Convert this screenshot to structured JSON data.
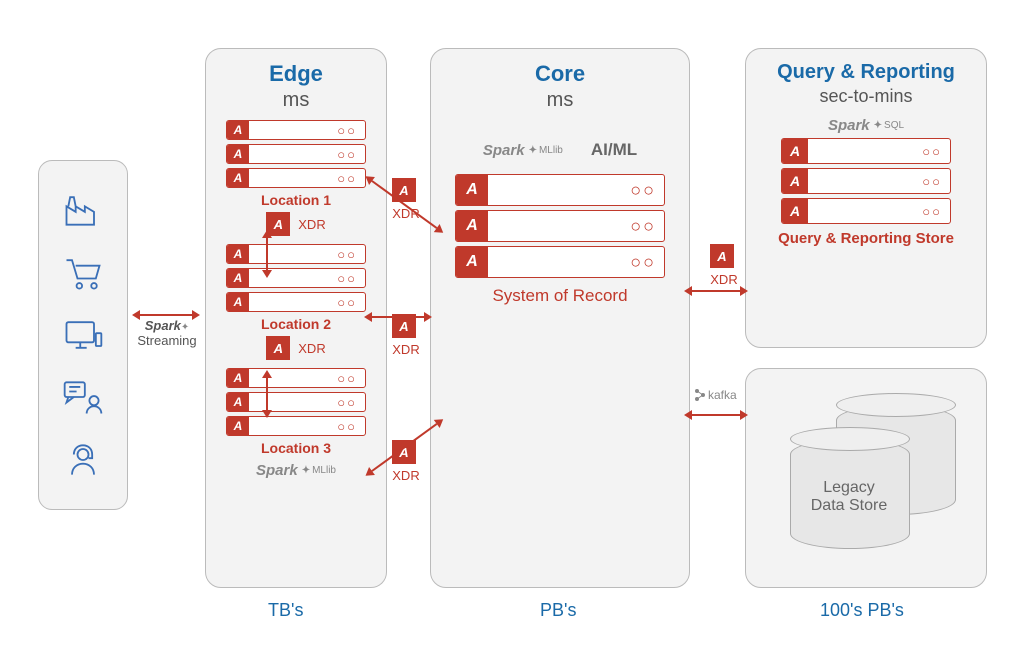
{
  "columns": {
    "edge": {
      "title": "Edge",
      "subtitle": "ms",
      "scale": "TB's"
    },
    "core": {
      "title": "Core",
      "subtitle": "ms",
      "scale": "PB's"
    },
    "query": {
      "title": "Query & Reporting",
      "subtitle": "sec-to-mins",
      "scale": "100's PB's"
    }
  },
  "edge": {
    "locations": [
      "Location 1",
      "Location 2",
      "Location 3"
    ],
    "xdr_label": "XDR",
    "spark_mllib": "Spark",
    "spark_mllib_suffix": "MLlib"
  },
  "core": {
    "spark_mllib": "Spark",
    "spark_mllib_suffix": "MLlib",
    "aiml": "AI/ML",
    "system_of_record": "System of Record"
  },
  "query": {
    "spark_sql": "Spark",
    "spark_sql_suffix": "SQL",
    "store_label": "Query & Reporting Store"
  },
  "legacy": {
    "label_line1": "Legacy",
    "label_line2": "Data Store",
    "kafka_label": "kafka"
  },
  "ingest": {
    "spark_streaming": "Spark",
    "spark_streaming_sub": "Streaming"
  },
  "source_icons": [
    "factory",
    "cart",
    "monitor",
    "chat-user",
    "headset-user"
  ],
  "glyph": {
    "a": "A",
    "dots": "○○"
  }
}
